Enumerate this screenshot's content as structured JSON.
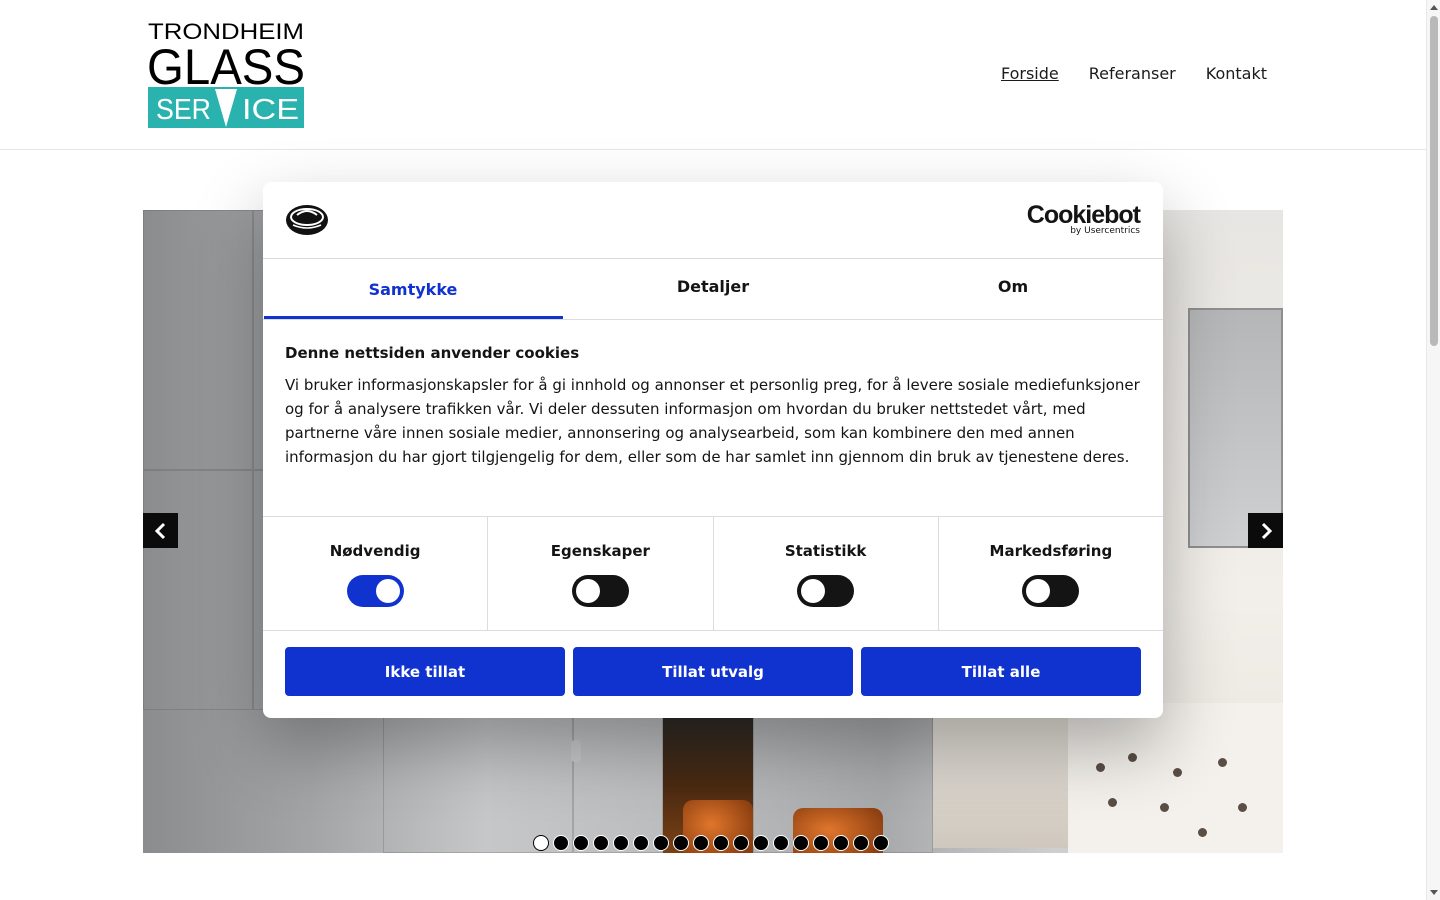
{
  "header": {
    "logo": {
      "line1": "TRONDHEIM",
      "line2": "GLASS",
      "line3": "SERVICE",
      "text_color": "#000000",
      "accent_color": "#2ab3ae"
    },
    "nav": [
      {
        "label": "Forside",
        "active": true
      },
      {
        "label": "Referanser",
        "active": false
      },
      {
        "label": "Kontakt",
        "active": false
      }
    ]
  },
  "slider": {
    "prev_icon": "chevron-left-icon",
    "next_icon": "chevron-right-icon",
    "slide_count": 18,
    "active_slide": 1
  },
  "cookie_dialog": {
    "brand": {
      "name": "Cookiebot",
      "by": "by Usercentrics"
    },
    "tabs": [
      {
        "label": "Samtykke",
        "active": true
      },
      {
        "label": "Detaljer",
        "active": false
      },
      {
        "label": "Om",
        "active": false
      }
    ],
    "heading": "Denne nettsiden anvender cookies",
    "body": "Vi bruker informasjonskapsler for å gi innhold og annonser et personlig preg, for å levere sosiale mediefunksjoner og for å analysere trafikken vår. Vi deler dessuten informasjon om hvordan du bruker nettstedet vårt, med partnerne våre innen sosiale medier, annonsering og analysearbeid, som kan kombinere den med annen informasjon du har gjort tilgjengelig for dem, eller som de har samlet inn gjennom din bruk av tjenestene deres.",
    "categories": [
      {
        "label": "Nødvendig",
        "enabled": true
      },
      {
        "label": "Egenskaper",
        "enabled": false
      },
      {
        "label": "Statistikk",
        "enabled": false
      },
      {
        "label": "Markedsføring",
        "enabled": false
      }
    ],
    "buttons": {
      "deny": "Ikke tillat",
      "allow_selection": "Tillat utvalg",
      "allow_all": "Tillat alle"
    },
    "accent_color": "#1032cf"
  }
}
